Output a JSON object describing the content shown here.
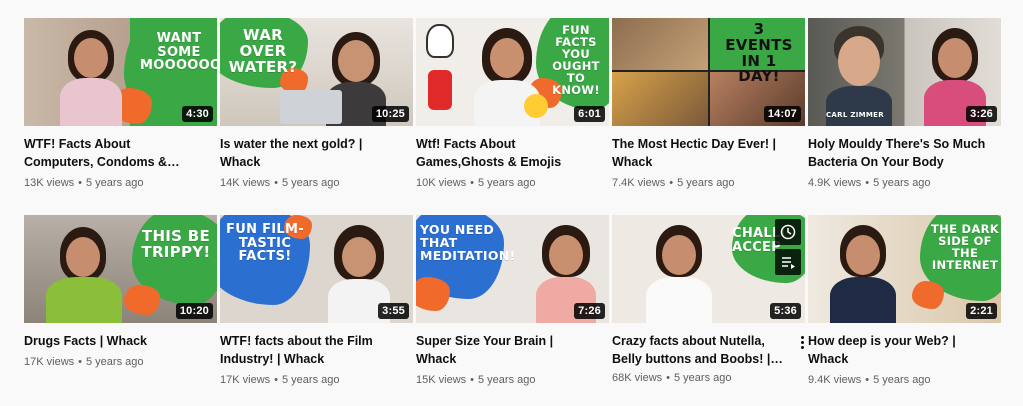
{
  "videos": [
    {
      "title": "WTF! Facts About Computers, Condoms & Chocolate",
      "overlay": "WANT SOME MOOOOOORE?",
      "duration": "4:30",
      "views": "13K views",
      "age": "5 years ago"
    },
    {
      "title": "Is water the next gold? | Whack",
      "overlay": "WAR OVER WATER?",
      "duration": "10:25",
      "views": "14K views",
      "age": "5 years ago"
    },
    {
      "title": "Wtf! Facts About Games,Ghosts & Emojis",
      "overlay": "FUN FACTS YOU OUGHT TO KNOW!",
      "duration": "6:01",
      "views": "10K views",
      "age": "5 years ago"
    },
    {
      "title": "The Most Hectic Day Ever! | Whack",
      "overlay": "3 EVENTS IN 1 DAY!",
      "duration": "14:07",
      "views": "7.4K views",
      "age": "5 years ago"
    },
    {
      "title": "Holy Mouldy There's So Much Bacteria On Your Body",
      "overlay": "CARL ZIMMER",
      "duration": "3:26",
      "views": "4.9K views",
      "age": "5 years ago"
    },
    {
      "title": "Drugs Facts | Whack",
      "overlay": "THIS BE TRIPPY!",
      "duration": "10:20",
      "views": "17K views",
      "age": "5 years ago"
    },
    {
      "title": "WTF! facts about the Film Industry! | Whack",
      "overlay": "FUN FILM-TASTIC FACTS!",
      "duration": "3:55",
      "views": "17K views",
      "age": "5 years ago"
    },
    {
      "title": "Super Size Your Brain | Whack",
      "overlay": "YOU NEED THAT MEDITATION!",
      "duration": "7:26",
      "views": "15K views",
      "age": "5 years ago"
    },
    {
      "title": "Crazy facts about Nutella, Belly buttons and Boobs! | Whack",
      "overlay": "CHALLE ACCEP",
      "duration": "5:36",
      "views": "68K views",
      "age": "5 years ago",
      "hover_icons": [
        "clock-icon",
        "add-to-queue-icon"
      ]
    },
    {
      "title": "How deep is your Web? | Whack",
      "overlay": "THE DARK SIDE OF THE INTERNET",
      "duration": "2:21",
      "views": "9.4K views",
      "age": "5 years ago"
    }
  ],
  "colors": {
    "brand_green": "#3aa845",
    "splash_orange": "#ef6a2b",
    "splash_blue": "#2b6fd1",
    "duration_bg": "#000000"
  }
}
